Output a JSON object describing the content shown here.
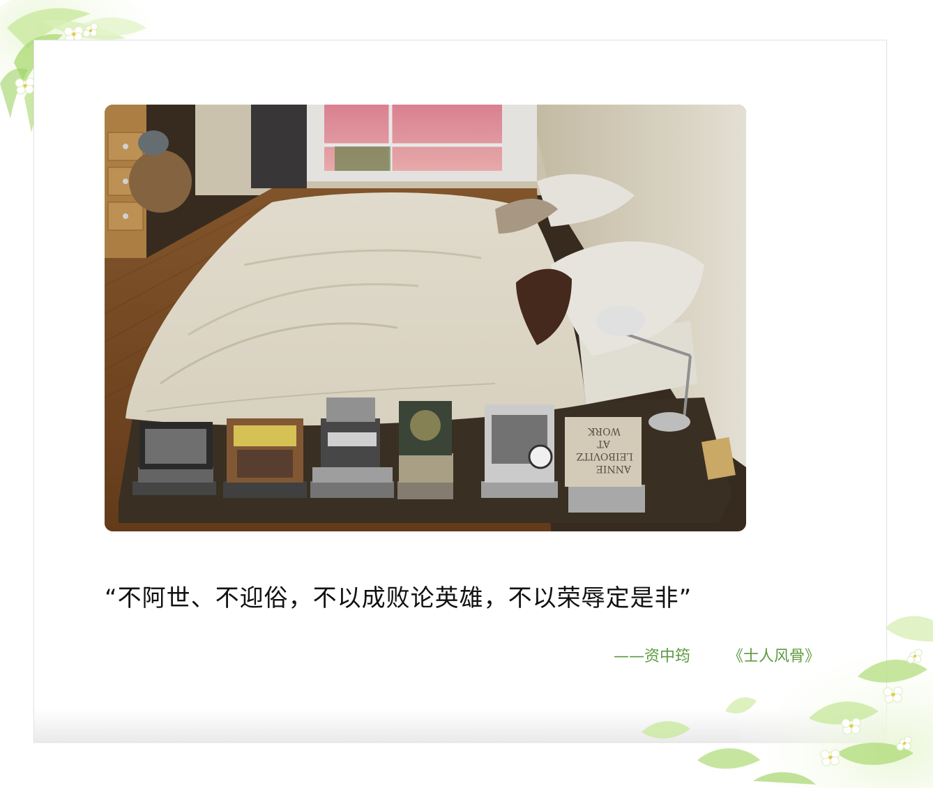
{
  "quote": {
    "text": "“不阿世、不迎俗，不以成败论英雄，不以荣辱定是非”"
  },
  "attribution": {
    "author": "——资中筠",
    "source": "《士人风骨》"
  },
  "colors": {
    "attribution": "#5c9a3f",
    "quote": "#111111",
    "frame_border": "#e2e2e2",
    "leaf_green": "#b9e08a"
  },
  "photo": {
    "subject": "bedroom-photo",
    "book_cover_text": [
      "ANNIE",
      "LEIBOVITZ",
      "AT",
      "WORK"
    ]
  },
  "decorations": [
    "leaf-flower-decoration-top-left",
    "leaf-flower-decoration-bottom-right"
  ]
}
